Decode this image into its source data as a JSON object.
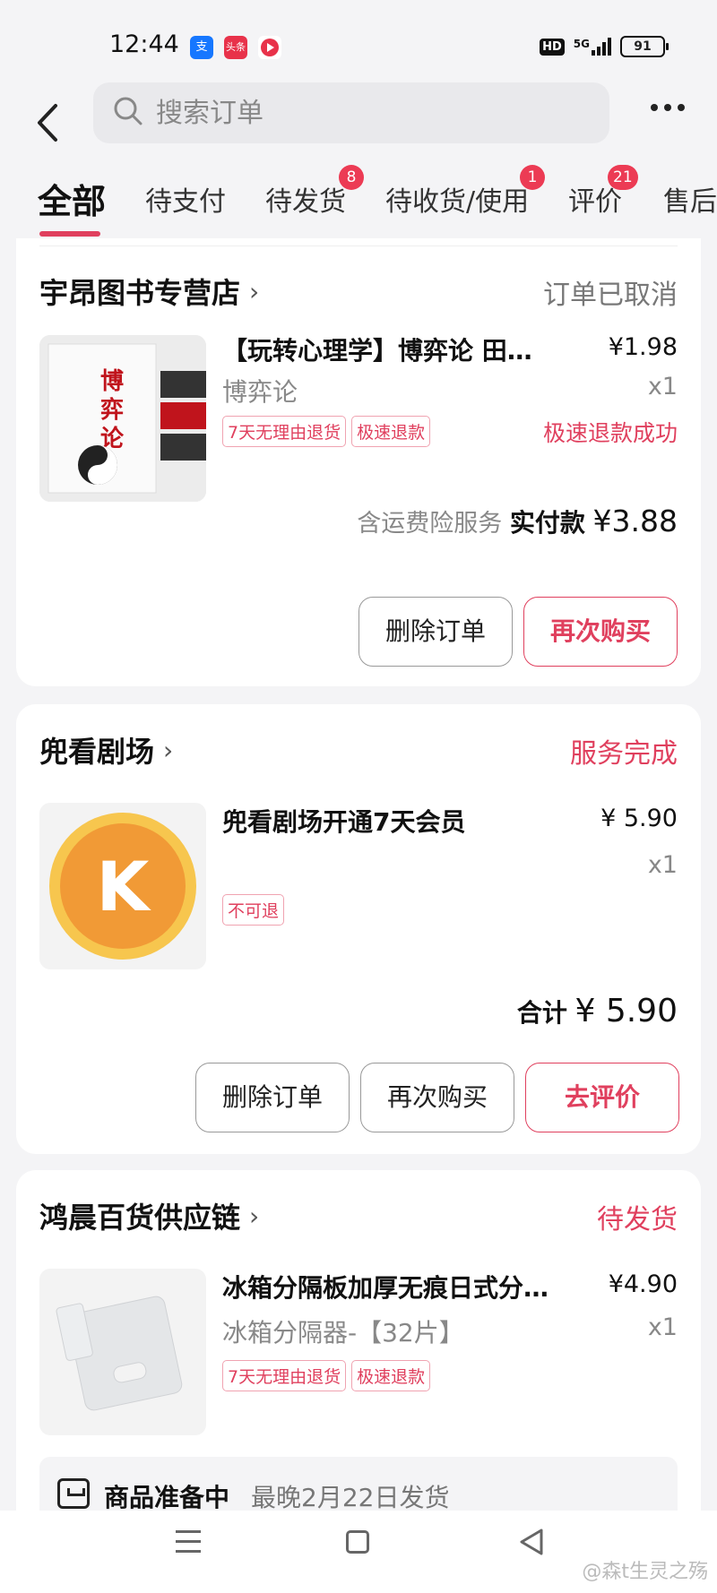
{
  "status_bar": {
    "time": "12:44",
    "apps": [
      "alipay-icon",
      "toutiao-icon",
      "video-icon"
    ],
    "hd": "HD",
    "network": "5G",
    "battery": "91"
  },
  "header": {
    "search_placeholder": "搜索订单"
  },
  "tabs": [
    {
      "label": "全部",
      "badge": ""
    },
    {
      "label": "待支付",
      "badge": ""
    },
    {
      "label": "待发货",
      "badge": "8"
    },
    {
      "label": "待收货/使用",
      "badge": "1"
    },
    {
      "label": "评价",
      "badge": "21"
    },
    {
      "label": "售后",
      "badge": ""
    }
  ],
  "orders": [
    {
      "store": "宇昂图书专营店",
      "status": "订单已取消",
      "status_color": "#777777",
      "product": "【玩转心理学】博弈论 田忌赛马",
      "price": "¥1.98",
      "spec": "博弈论",
      "qty": "x1",
      "tags": [
        "7天无理由退货",
        "极速退款"
      ],
      "refund_status": "极速退款成功",
      "total_prefix": "含运费险服务",
      "total_label": "实付款",
      "total_amount": "¥3.88",
      "buttons": [
        "删除订单",
        "再次购买"
      ],
      "thumb_text": "博弈论"
    },
    {
      "store": "兜看剧场",
      "status": "服务完成",
      "status_color": "#e0405e",
      "product": "兜看剧场开通7天会员",
      "price": "¥ 5.90",
      "qty": "x1",
      "tags": [
        "不可退"
      ],
      "total_label": "合计",
      "total_amount": "¥ 5.90",
      "buttons": [
        "删除订单",
        "再次购买",
        "去评价"
      ],
      "thumb_text": "K"
    },
    {
      "store": "鸿晨百货供应链",
      "status": "待发货",
      "status_color": "#e0405e",
      "product": "冰箱分隔板加厚无痕日式分隔板",
      "price": "¥4.90",
      "spec": "冰箱分隔器-【32片】",
      "qty": "x1",
      "tags": [
        "7天无理由退货",
        "极速退款"
      ],
      "shipping_label": "商品准备中",
      "shipping_note": "最晚2月22日发货"
    }
  ],
  "watermark": "@森t生灵之殇",
  "colors": {
    "accent": "#e0405e",
    "background": "#f4f4f6"
  }
}
